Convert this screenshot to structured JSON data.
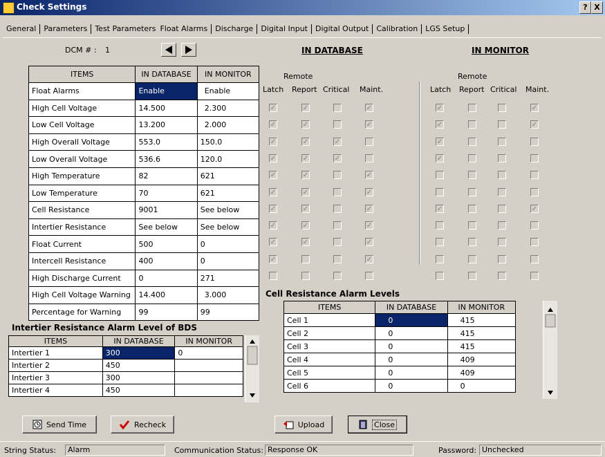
{
  "window": {
    "title": "Check Settings",
    "help": "?",
    "close": "X"
  },
  "tabs": [
    {
      "label": "General"
    },
    {
      "label": "Parameters"
    },
    {
      "label": "Test Parameters"
    },
    {
      "label": "Float Alarms"
    },
    {
      "label": "Discharge"
    },
    {
      "label": "Digital Input"
    },
    {
      "label": "Digital Output"
    },
    {
      "label": "Calibration"
    },
    {
      "label": "LGS Setup"
    }
  ],
  "dcm": {
    "label": "DCM # :",
    "value": "1"
  },
  "sections": {
    "in_database": "IN DATABASE",
    "in_monitor": "IN MONITOR"
  },
  "items_table": {
    "headers": [
      "ITEMS",
      "IN DATABASE",
      "IN MONITOR"
    ],
    "rows": [
      {
        "item": "Float Alarms",
        "db": "Enable",
        "mon": "Enable"
      },
      {
        "item": "High Cell Voltage",
        "db": "14.500",
        "mon": "2.300"
      },
      {
        "item": "Low Cell Voltage",
        "db": "13.200",
        "mon": "2.000"
      },
      {
        "item": "High Overall Voltage",
        "db": "553.0",
        "mon": "150.0"
      },
      {
        "item": "Low Overall Voltage",
        "db": "536.6",
        "mon": "120.0"
      },
      {
        "item": "High Temperature",
        "db": "82",
        "mon": "621"
      },
      {
        "item": "Low Temperature",
        "db": "70",
        "mon": "621"
      },
      {
        "item": "Cell Resistance",
        "db": "9001",
        "mon": "See below"
      },
      {
        "item": "Intertier Resistance",
        "db": "See below",
        "mon": "See below"
      },
      {
        "item": "Float Current",
        "db": "500",
        "mon": "0"
      },
      {
        "item": "Intercell Resistance",
        "db": "400",
        "mon": "0"
      },
      {
        "item": "High Discharge Current",
        "db": "0",
        "mon": "271"
      },
      {
        "item": "High Cell Voltage Warning",
        "db": "14.400",
        "mon": "3.000"
      },
      {
        "item": "Percentage for Warning",
        "db": "99",
        "mon": "99"
      }
    ]
  },
  "checkbox_headers": {
    "remote": "Remote",
    "latch": "Latch",
    "report": "Report",
    "critical": "Critical",
    "maint": "Maint."
  },
  "db_checks": [
    [
      1,
      1,
      0,
      1
    ],
    [
      1,
      1,
      0,
      1
    ],
    [
      1,
      1,
      1,
      0
    ],
    [
      1,
      1,
      1,
      0
    ],
    [
      1,
      1,
      0,
      1
    ],
    [
      1,
      1,
      0,
      1
    ],
    [
      1,
      1,
      0,
      1
    ],
    [
      1,
      1,
      0,
      1
    ],
    [
      1,
      1,
      0,
      1
    ],
    [
      1,
      0,
      0,
      1
    ],
    [
      0,
      0,
      0,
      0
    ]
  ],
  "mon_checks": [
    [
      1,
      0,
      0,
      1
    ],
    [
      1,
      0,
      0,
      1
    ],
    [
      1,
      0,
      0,
      0
    ],
    [
      1,
      0,
      0,
      0
    ],
    [
      0,
      0,
      0,
      0
    ],
    [
      0,
      0,
      0,
      0
    ],
    [
      1,
      0,
      0,
      1
    ],
    [
      0,
      0,
      0,
      0
    ],
    [
      0,
      0,
      0,
      0
    ],
    [
      0,
      0,
      0,
      0
    ],
    [
      0,
      0,
      0,
      0
    ]
  ],
  "intertier": {
    "title": "Intertier Resistance Alarm Level of BDS",
    "headers": [
      "ITEMS",
      "IN DATABASE",
      "IN MONITOR"
    ],
    "rows": [
      {
        "item": "Intertier 1",
        "db": "300",
        "mon": "0"
      },
      {
        "item": "Intertier 2",
        "db": "450",
        "mon": ""
      },
      {
        "item": "Intertier 3",
        "db": "300",
        "mon": ""
      },
      {
        "item": "Intertier 4",
        "db": "450",
        "mon": ""
      }
    ]
  },
  "cell_res": {
    "title": "Cell Resistance Alarm Levels",
    "headers": [
      "ITEMS",
      "IN DATABASE",
      "IN MONITOR"
    ],
    "rows": [
      {
        "item": "Cell 1",
        "db": "0",
        "mon": "415"
      },
      {
        "item": "Cell 2",
        "db": "0",
        "mon": "415"
      },
      {
        "item": "Cell 3",
        "db": "0",
        "mon": "415"
      },
      {
        "item": "Cell 4",
        "db": "0",
        "mon": "409"
      },
      {
        "item": "Cell 5",
        "db": "0",
        "mon": "409"
      },
      {
        "item": "Cell 6",
        "db": "0",
        "mon": "0"
      }
    ]
  },
  "buttons": {
    "send_time": "Send Time",
    "recheck": "Recheck",
    "upload": "Upload",
    "close": "Close"
  },
  "status": {
    "string_label": "String Status:",
    "string_value": "Alarm",
    "comm_label": "Communication Status:",
    "comm_value": "Response OK",
    "password_label": "Password:",
    "password_value": "Unchecked"
  }
}
